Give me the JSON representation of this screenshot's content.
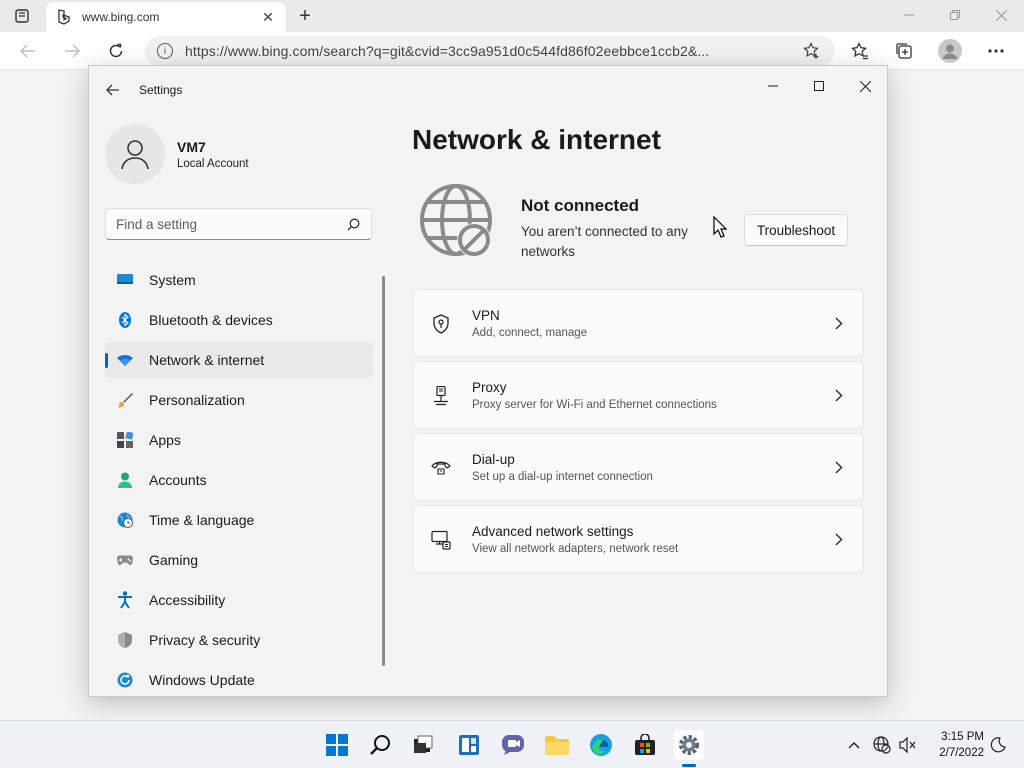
{
  "browser": {
    "tab_title": "www.bing.com",
    "url": "https://www.bing.com/search?q=git&cvid=3cc9a951d0c544fd86f02eebbce1ccb2&..."
  },
  "settings": {
    "window_title": "Settings",
    "profile": {
      "name": "VM7",
      "account_type": "Local Account"
    },
    "search_placeholder": "Find a setting",
    "nav": [
      {
        "label": "System",
        "icon": "monitor-icon",
        "active": false
      },
      {
        "label": "Bluetooth & devices",
        "icon": "bluetooth-icon",
        "active": false
      },
      {
        "label": "Network & internet",
        "icon": "wifi-icon",
        "active": true
      },
      {
        "label": "Personalization",
        "icon": "brush-icon",
        "active": false
      },
      {
        "label": "Apps",
        "icon": "apps-icon",
        "active": false
      },
      {
        "label": "Accounts",
        "icon": "person-icon",
        "active": false
      },
      {
        "label": "Time & language",
        "icon": "globe-clock-icon",
        "active": false
      },
      {
        "label": "Gaming",
        "icon": "gamepad-icon",
        "active": false
      },
      {
        "label": "Accessibility",
        "icon": "accessibility-icon",
        "active": false
      },
      {
        "label": "Privacy & security",
        "icon": "shield-icon",
        "active": false
      },
      {
        "label": "Windows Update",
        "icon": "update-icon",
        "active": false
      }
    ],
    "page_title": "Network & internet",
    "status": {
      "title": "Not connected",
      "description": "You aren’t connected to any networks",
      "button": "Troubleshoot"
    },
    "cards": [
      {
        "title": "VPN",
        "subtitle": "Add, connect, manage",
        "icon": "vpn-shield-icon"
      },
      {
        "title": "Proxy",
        "subtitle": "Proxy server for Wi-Fi and Ethernet connections",
        "icon": "proxy-icon"
      },
      {
        "title": "Dial-up",
        "subtitle": "Set up a dial-up internet connection",
        "icon": "dialup-icon"
      },
      {
        "title": "Advanced network settings",
        "subtitle": "View all network adapters, network reset",
        "icon": "network-adapter-icon"
      }
    ]
  },
  "taskbar": {
    "time": "3:15 PM",
    "date": "2/7/2022"
  },
  "colors": {
    "accent": "#0067c0"
  }
}
